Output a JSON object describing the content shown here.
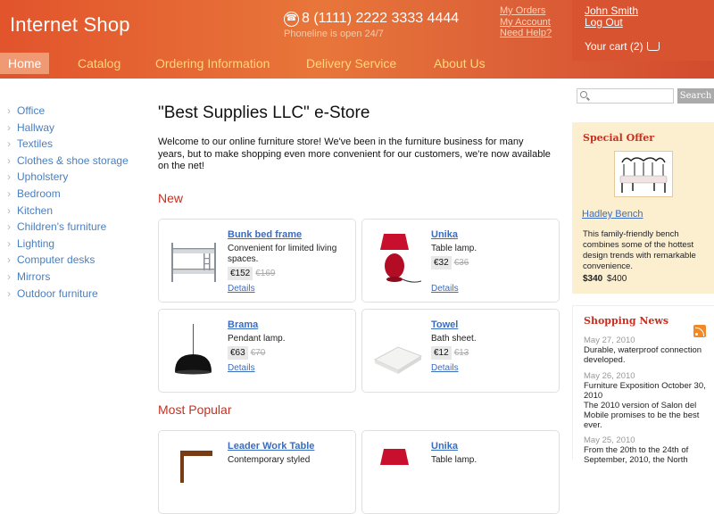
{
  "header": {
    "logo": "Internet Shop",
    "phone": "8 (1111) 2222 3333 4444",
    "phone_note": "Phoneline is open 24/7",
    "links": [
      "My Orders",
      "My Account",
      "Need Help?"
    ],
    "user_name": "John Smith",
    "logout": "Log Out",
    "cart": "Your cart (2)"
  },
  "nav": {
    "items": [
      {
        "label": "Home",
        "active": true
      },
      {
        "label": "Catalog"
      },
      {
        "label": "Ordering Information"
      },
      {
        "label": "Delivery Service"
      },
      {
        "label": "About Us"
      }
    ]
  },
  "sidebar": {
    "categories": [
      "Office",
      "Hallway",
      "Textiles",
      "Clothes & shoe storage",
      "Upholstery",
      "Bedroom",
      "Kitchen",
      "Children's furniture",
      "Lighting",
      "Computer desks",
      "Mirrors",
      "Outdoor furniture"
    ]
  },
  "main": {
    "title": "\"Best Supplies LLC\" e-Store",
    "welcome": "Welcome to our online furniture store! We've been in the furniture business for many years, but to make shopping even more convenient for our customers, we're now available on the net!",
    "new_heading": "New",
    "popular_heading": "Most Popular",
    "details_label": "Details",
    "new_products": [
      {
        "name": "Bunk bed frame",
        "desc": "Convenient for limited living spaces.",
        "price": "€152",
        "old_price": "€169"
      },
      {
        "name": "Unika",
        "desc": "Table lamp.",
        "price": "€32",
        "old_price": "€36"
      },
      {
        "name": "Brama",
        "desc": "Pendant lamp.",
        "price": "€63",
        "old_price": "€70"
      },
      {
        "name": "Towel",
        "desc": "Bath sheet.",
        "price": "€12",
        "old_price": "€13"
      }
    ],
    "popular_products": [
      {
        "name": "Leader Work Table",
        "desc": "Contemporary styled"
      },
      {
        "name": "Unika",
        "desc": "Table lamp."
      }
    ]
  },
  "search": {
    "placeholder": "",
    "button": "Search"
  },
  "special_offer": {
    "heading": "Special Offer",
    "name": "Hadley Bench",
    "desc": "This family-friendly bench combines some of the hottest design trends with remarkable convenience.",
    "price": "$340",
    "old_price": "$400"
  },
  "news": {
    "heading": "Shopping News",
    "items": [
      {
        "date": "May 27, 2010",
        "text": "Durable, waterproof connection developed."
      },
      {
        "date": "May 26, 2010",
        "text": "Furniture Exposition October 30, 2010",
        "text2": "The 2010 version of Salon del Mobile promises to be the best ever."
      },
      {
        "date": "May 25, 2010",
        "text": "From the 20th to the 24th of September, 2010, the North"
      }
    ]
  },
  "colors": {
    "header": "#e2542c",
    "nav_text": "#ffd77a",
    "accent": "#c7301f",
    "link": "#3a6cc0",
    "offer_bg": "#fcefd0"
  }
}
